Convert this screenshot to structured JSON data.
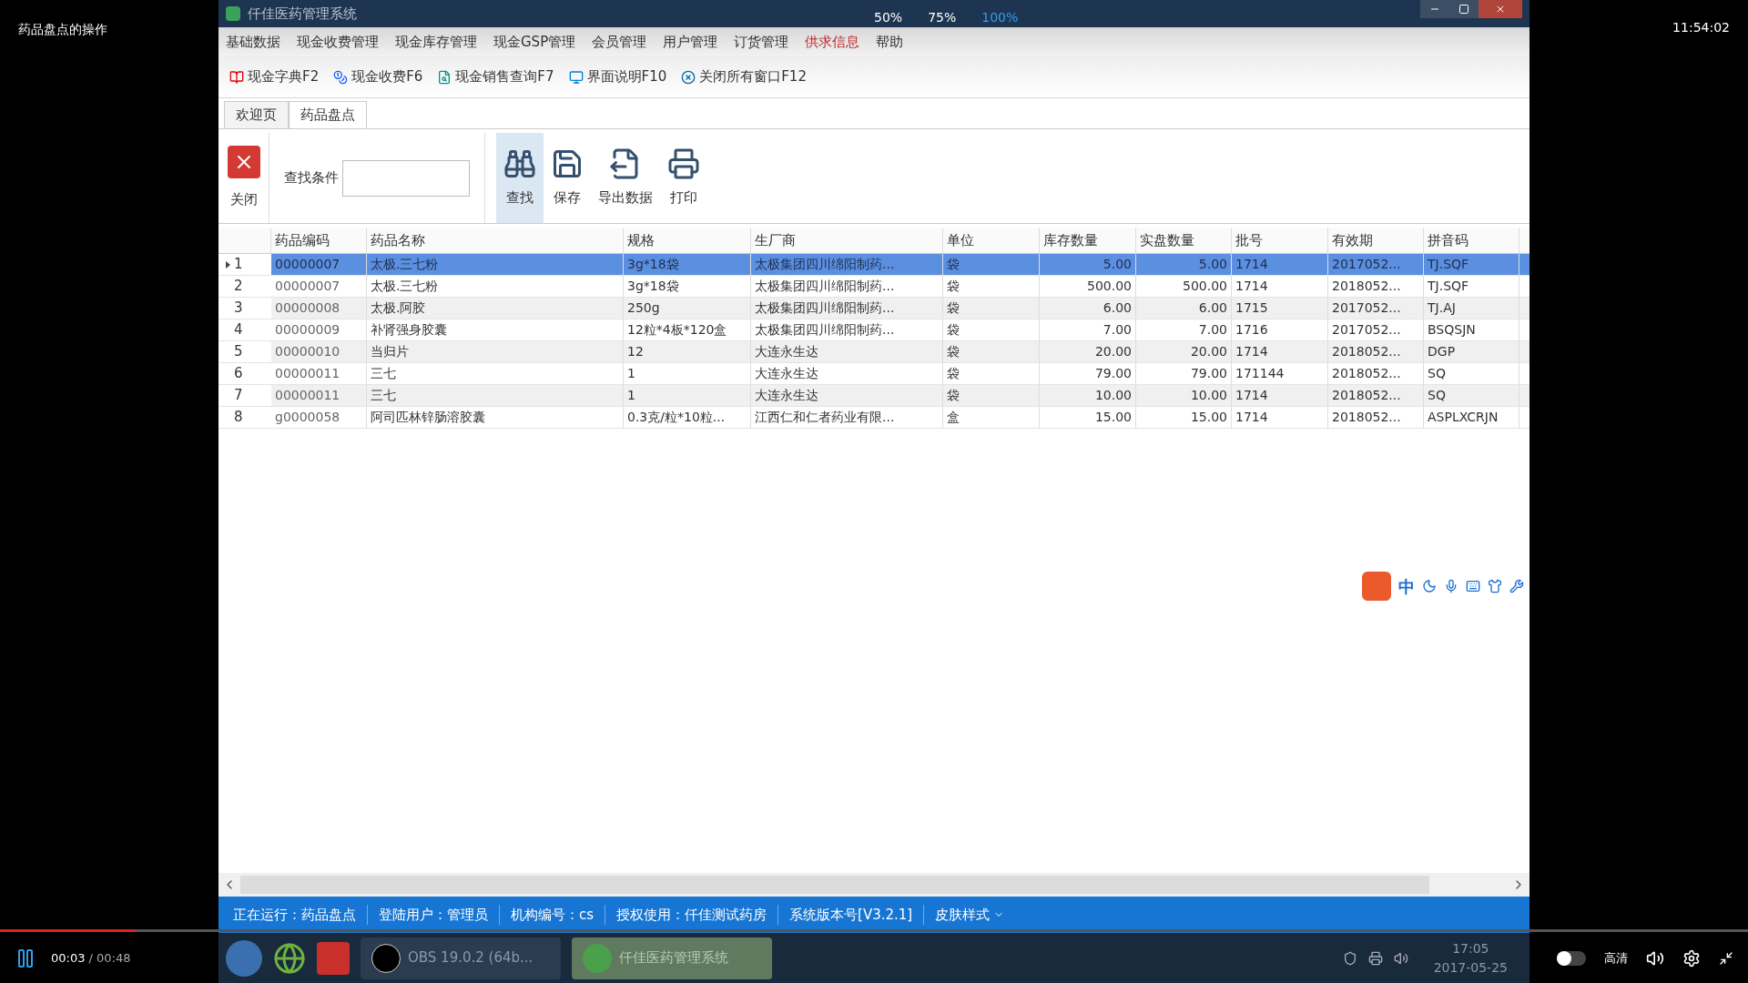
{
  "player": {
    "title": "药品盘点的操作",
    "clock": "11:54:02",
    "zoom_options": [
      {
        "label": "50%",
        "selected": false
      },
      {
        "label": "75%",
        "selected": false
      },
      {
        "label": "100%",
        "selected": true
      }
    ],
    "toggle": {
      "on": false
    },
    "elapsed": "00:03",
    "duration": "/ 00:48",
    "progress": {
      "level": 0.077
    },
    "quality": "高清"
  },
  "window": {
    "title": "仟佳医药管理系统"
  },
  "menu": [
    {
      "label": "基础数据",
      "highlighted": false
    },
    {
      "label": "现金收费管理",
      "highlighted": false
    },
    {
      "label": "现金库存管理",
      "highlighted": false
    },
    {
      "label": "现金GSP管理",
      "highlighted": false
    },
    {
      "label": "会员管理",
      "highlighted": false
    },
    {
      "label": "用户管理",
      "highlighted": false
    },
    {
      "label": "订货管理",
      "highlighted": false
    },
    {
      "label": "供求信息",
      "highlighted": true
    },
    {
      "label": "帮助",
      "highlighted": false
    }
  ],
  "toolbar": [
    {
      "label": "现金字典F2",
      "kind": "dictionary"
    },
    {
      "label": "现金收费F6",
      "kind": "money"
    },
    {
      "label": "现金销售查询F7",
      "kind": "query"
    },
    {
      "label": "界面说明F10",
      "kind": "screen"
    },
    {
      "label": "关闭所有窗口F12",
      "kind": "close-all"
    }
  ],
  "tabs": [
    {
      "label": "欢迎页",
      "selected": false
    },
    {
      "label": "药品盘点",
      "selected": true
    }
  ],
  "ribbon": {
    "close": "关闭",
    "search_label": "查找条件",
    "buttons": [
      {
        "label": "查找",
        "kind": "search",
        "selected": true
      },
      {
        "label": "保存",
        "kind": "save",
        "selected": false
      },
      {
        "label": "导出数据",
        "kind": "export",
        "selected": false
      },
      {
        "label": "打印",
        "kind": "print",
        "selected": false
      }
    ]
  },
  "table": {
    "columns": [
      "药品编码",
      "药品名称",
      "规格",
      "生厂商",
      "单位",
      "库存数量",
      "实盘数量",
      "批号",
      "有效期",
      "拼音码"
    ],
    "rows": [
      {
        "number": "1",
        "selected": true,
        "cells": [
          "00000007",
          "太极.三七粉",
          "3g*18袋",
          "太极集团四川绵阳制药...",
          "袋",
          "5.00",
          "5.00",
          "1714",
          "2017052...",
          "TJ.SQF"
        ]
      },
      {
        "number": "2",
        "selected": false,
        "cells": [
          "00000007",
          "太极.三七粉",
          "3g*18袋",
          "太极集团四川绵阳制药...",
          "袋",
          "500.00",
          "500.00",
          "1714",
          "2018052...",
          "TJ.SQF"
        ]
      },
      {
        "number": "3",
        "selected": false,
        "cells": [
          "00000008",
          "太极.阿胶",
          "250g",
          "太极集团四川绵阳制药...",
          "袋",
          "6.00",
          "6.00",
          "1715",
          "2017052...",
          "TJ.AJ"
        ]
      },
      {
        "number": "4",
        "selected": false,
        "cells": [
          "00000009",
          "补肾强身胶囊",
          "12粒*4板*120盒",
          "太极集团四川绵阳制药...",
          "袋",
          "7.00",
          "7.00",
          "1716",
          "2017052...",
          "BSQSJN"
        ]
      },
      {
        "number": "5",
        "selected": false,
        "cells": [
          "00000010",
          "当归片",
          "12",
          "大连永生达",
          "袋",
          "20.00",
          "20.00",
          "1714",
          "2018052...",
          "DGP"
        ]
      },
      {
        "number": "6",
        "selected": false,
        "cells": [
          "00000011",
          "三七",
          "1",
          "大连永生达",
          "袋",
          "79.00",
          "79.00",
          "171144",
          "2018052...",
          "SQ"
        ]
      },
      {
        "number": "7",
        "selected": false,
        "cells": [
          "00000011",
          "三七",
          "1",
          "大连永生达",
          "袋",
          "10.00",
          "10.00",
          "1714",
          "2018052...",
          "SQ"
        ]
      },
      {
        "number": "8",
        "selected": false,
        "cells": [
          "g0000058",
          "阿司匹林锌肠溶胶囊",
          "0.3克/粒*10粒...",
          "江西仁和仁者药业有限...",
          "盒",
          "15.00",
          "15.00",
          "1714",
          "2018052...",
          "ASPLXCRJN"
        ]
      }
    ]
  },
  "ime_bar": {
    "mode": "中"
  },
  "status_bar": [
    "正在运行：药品盘点",
    "登陆用户：管理员",
    "机构编号：cs",
    "授权使用：仟佳测试药房",
    "系统版本号[V3.2.1]",
    "皮肤样式"
  ],
  "taskbar": {
    "tasks": [
      {
        "label": "OBS 19.0.2 (64b...",
        "selected": false
      },
      {
        "label": "仟佳医药管理系统",
        "selected": true
      }
    ],
    "time": "17:05",
    "date": "2017-05-25"
  }
}
